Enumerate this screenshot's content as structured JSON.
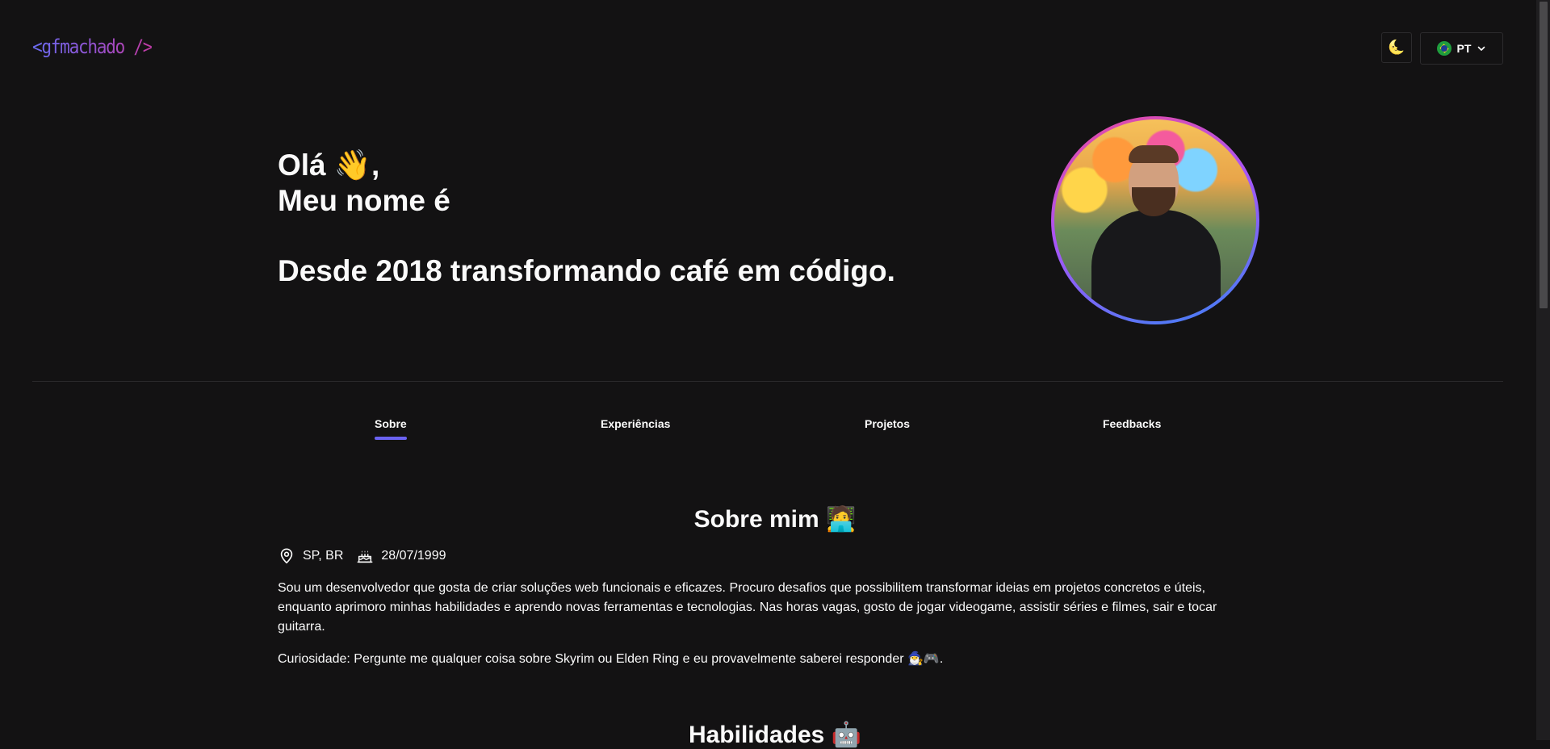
{
  "header": {
    "logo": "<gfmachado />",
    "theme_icon": "🌜",
    "language": "PT",
    "flag_icon": "brazil-flag-icon"
  },
  "hero": {
    "greeting": "Olá 👋,",
    "name_line": "Meu nome é",
    "tagline": "Desde 2018 transformando café em código."
  },
  "tabs": [
    {
      "label": "Sobre",
      "active": true
    },
    {
      "label": "Experiências",
      "active": false
    },
    {
      "label": "Projetos",
      "active": false
    },
    {
      "label": "Feedbacks",
      "active": false
    }
  ],
  "about": {
    "title": "Sobre mim 🧑‍💻",
    "location": "SP, BR",
    "birthday": "28/07/1999",
    "description": "Sou um desenvolvedor que gosta de criar soluções web funcionais e eficazes. Procuro desafios que possibilitem transformar ideias em projetos concretos e úteis, enquanto aprimoro minhas habilidades e aprendo novas ferramentas e tecnologias. Nas horas vagas, gosto de jogar videogame, assistir séries e filmes, sair e tocar guitarra.",
    "curiosity": "Curiosidade: Pergunte me qualquer coisa sobre Skyrim ou Elden Ring e eu provavelmente saberei responder 🧙‍♂️🎮."
  },
  "skills": {
    "title": "Habilidades 🤖"
  },
  "colors": {
    "background": "#131213",
    "accent": "#6b63f2",
    "logo_gradient_start": "#6a6cf2",
    "logo_gradient_end": "#c13aa3"
  }
}
